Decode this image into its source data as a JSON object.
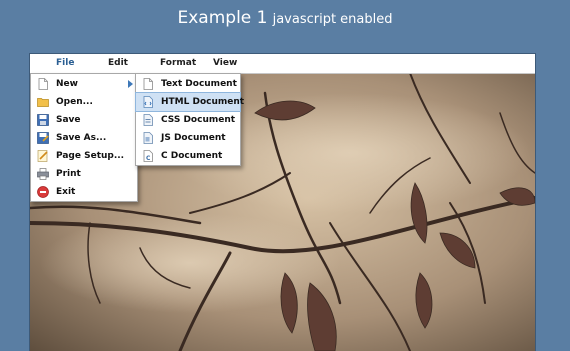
{
  "header": {
    "title_big": "Example 1",
    "title_small": "javascript enabled"
  },
  "menubar": {
    "items": [
      "File",
      "Edit",
      "Format",
      "View"
    ],
    "active": "File"
  },
  "file_menu": {
    "items": [
      {
        "label": "New",
        "icon": "new-file-icon",
        "submenu": true
      },
      {
        "label": "Open...",
        "icon": "folder-icon"
      },
      {
        "label": "Save",
        "icon": "save-icon"
      },
      {
        "label": "Save As...",
        "icon": "save-as-icon"
      },
      {
        "label": "Page Setup...",
        "icon": "page-setup-icon"
      },
      {
        "label": "Print",
        "icon": "printer-icon"
      },
      {
        "label": "Exit",
        "icon": "exit-icon"
      }
    ]
  },
  "new_submenu": {
    "items": [
      {
        "label": "Text Document",
        "icon": "text-document-icon"
      },
      {
        "label": "HTML Document",
        "icon": "html-document-icon"
      },
      {
        "label": "CSS Document",
        "icon": "css-document-icon"
      },
      {
        "label": "JS Document",
        "icon": "js-document-icon"
      },
      {
        "label": "C Document",
        "icon": "c-document-icon"
      }
    ],
    "highlighted": "HTML Document"
  },
  "colors": {
    "background": "#5a7ea3",
    "menu_highlight": "#cfe1f4",
    "active_menu_text": "#2b5f93"
  }
}
